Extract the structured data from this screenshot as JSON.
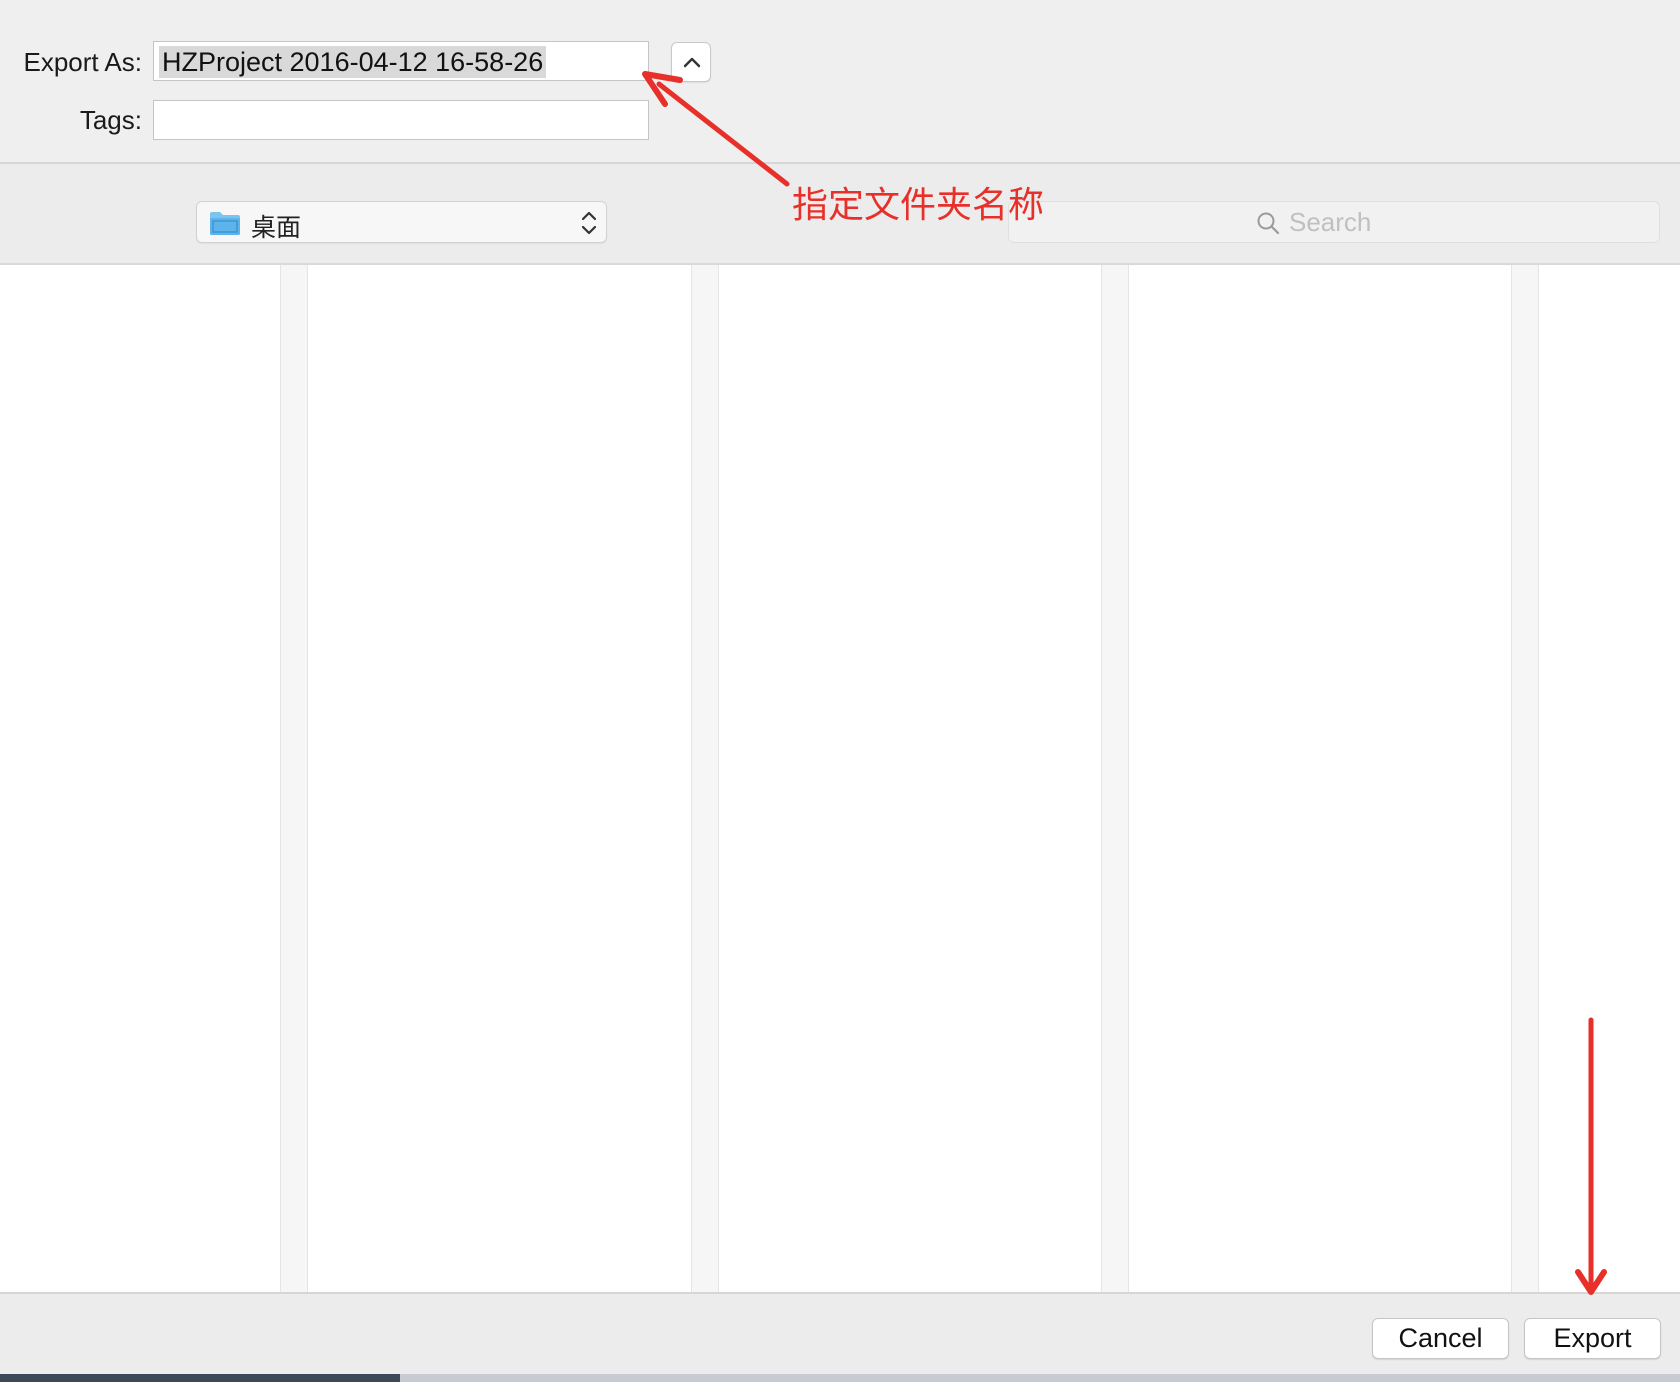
{
  "dialog": {
    "export_as_label": "Export As:",
    "export_as_value": "HZProject 2016-04-12 16-58-26",
    "tags_label": "Tags:",
    "tags_value": ""
  },
  "location": {
    "folder_name": "桌面",
    "folder_icon": "folder-icon",
    "search_placeholder": "Search"
  },
  "buttons": {
    "cancel_label": "Cancel",
    "export_label": "Export"
  },
  "annotations": {
    "callout_text": "指定文件夹名称",
    "color": "#e8302a"
  },
  "colors": {
    "dialog_bg": "#ececec",
    "folder_blue": "#5db3ea"
  }
}
